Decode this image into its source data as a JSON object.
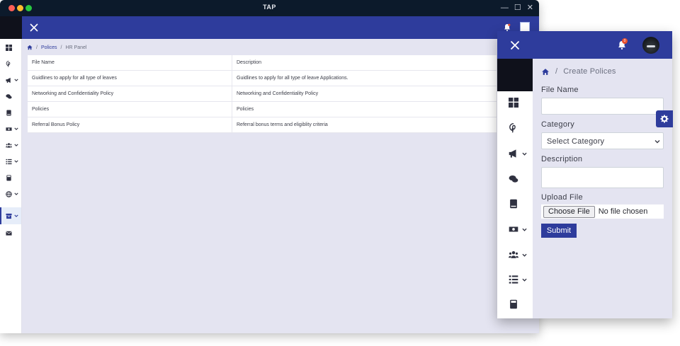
{
  "window": {
    "title": "TAP",
    "controls": [
      "—",
      "☐",
      "✕"
    ]
  },
  "back_page": {
    "breadcrumb": {
      "first": "Polices",
      "second": "HR Panel",
      "separator": "/"
    },
    "table": {
      "headers": [
        "File Name",
        "Description"
      ],
      "rows": [
        [
          "Guidlines to apply for all type of leaves",
          "Guidlines to apply for all type of leave Applications."
        ],
        [
          "Networking and Confidentiality Policy",
          "Networking and Confidentiality Policy"
        ],
        [
          "Policies",
          "Policies"
        ],
        [
          "Referral Bonus Policy",
          "Referral bonus terms and eligiblity criteria"
        ]
      ]
    }
  },
  "front_page": {
    "notification_count": "0",
    "breadcrumb": {
      "separator": "/",
      "current": "Create Polices"
    },
    "form": {
      "file_name_label": "File Name",
      "file_name_value": "",
      "category_label": "Category",
      "category_selected": "Select Category",
      "description_label": "Description",
      "description_value": "",
      "upload_label": "Upload File",
      "choose_file_label": "Choose File",
      "no_file_text": "No file chosen",
      "submit_label": "Submit"
    }
  },
  "icons": {
    "sidebar": [
      "dashboard-icon",
      "pinterest-icon",
      "megaphone-icon",
      "chat-icon",
      "book-icon",
      "money-icon",
      "users-icon",
      "tasks-icon",
      "calculator-icon",
      "globe-icon",
      "archive-icon",
      "envelope-icon"
    ]
  },
  "colors": {
    "brand": "#2e3c9c",
    "dark": "#0f111b",
    "background": "#e4e4f1",
    "notification": "#e8502e"
  }
}
